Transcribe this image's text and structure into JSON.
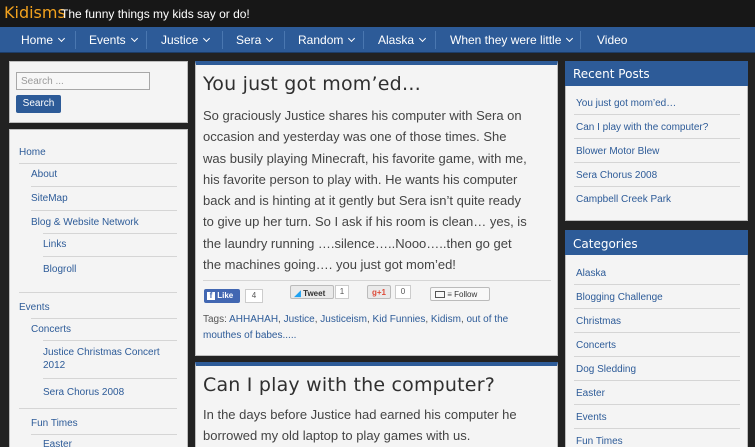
{
  "header": {
    "site_title": "Kidisms",
    "tagline": "The funny things my kids say or do!"
  },
  "nav": [
    {
      "label": "Home",
      "dropdown": true
    },
    {
      "label": "Events",
      "dropdown": true
    },
    {
      "label": "Justice",
      "dropdown": true
    },
    {
      "label": "Sera",
      "dropdown": true
    },
    {
      "label": "Random",
      "dropdown": true
    },
    {
      "label": "Alaska",
      "dropdown": true
    },
    {
      "label": "When they were little",
      "dropdown": true
    },
    {
      "label": "Video",
      "dropdown": false
    }
  ],
  "search": {
    "placeholder": "Search ...",
    "button_label": "Search"
  },
  "left_menu": [
    {
      "label": "Home"
    },
    {
      "label": "About"
    },
    {
      "label": "SiteMap"
    },
    {
      "label": "Blog & Website Network"
    },
    {
      "label": "Links"
    },
    {
      "label": "Blogroll"
    },
    {
      "label": "Events"
    },
    {
      "label": "Concerts"
    },
    {
      "label": "Justice Christmas Concert 2012"
    },
    {
      "label": "Sera Chorus 2008"
    },
    {
      "label": "Fun Times"
    },
    {
      "label": "Easter"
    }
  ],
  "posts": [
    {
      "title": "You just got mom’ed…",
      "body_lines": [
        "So graciously Justice shares his computer with Sera on",
        "occasion and yesterday was one of those times. She",
        "was busily playing Minecraft, his favorite game, with me,",
        "his favorite person to play with. He wants his computer",
        "back and is hinting at it gently but Sera isn’t quite ready",
        "to give up her turn. So I ask if his room is clean… yes, is",
        "the laundry running ….silence…..Nooo…..then go get",
        "the machines going…. you just got mom’ed!"
      ],
      "share": {
        "like_label": "Like",
        "like_count": "4",
        "tweet_label": "Tweet",
        "tweet_count": "1",
        "gplus_label": "+1",
        "gplus_count": "0",
        "follow_label": "Follow"
      },
      "tags_label": "Tags:",
      "tags": [
        "AHHAHAH",
        "Justice",
        "Justiceism",
        "Kid Funnies",
        "Kidism",
        "out of the mouthes of babes....."
      ]
    },
    {
      "title": "Can I play with the computer?",
      "body_lines": [
        "In the days before Justice had earned his computer he",
        "borrowed my old laptop to play games with us."
      ]
    }
  ],
  "recent_posts": {
    "heading": "Recent Posts",
    "items": [
      {
        "label": "You just got mom’ed…"
      },
      {
        "label": "Can I play with the computer?"
      },
      {
        "label": "Blower Motor Blew"
      },
      {
        "label": "Sera Chorus 2008"
      },
      {
        "label": "Campbell Creek Park"
      }
    ]
  },
  "categories": {
    "heading": "Categories",
    "items": [
      {
        "label": "Alaska"
      },
      {
        "label": "Blogging Challenge"
      },
      {
        "label": "Christmas"
      },
      {
        "label": "Concerts"
      },
      {
        "label": "Dog Sledding"
      },
      {
        "label": "Easter"
      },
      {
        "label": "Events"
      },
      {
        "label": "Fun Times"
      }
    ]
  },
  "colors": {
    "accent_blue": "#2d5b98",
    "title_orange": "#f2a21e",
    "background": "#222222"
  }
}
